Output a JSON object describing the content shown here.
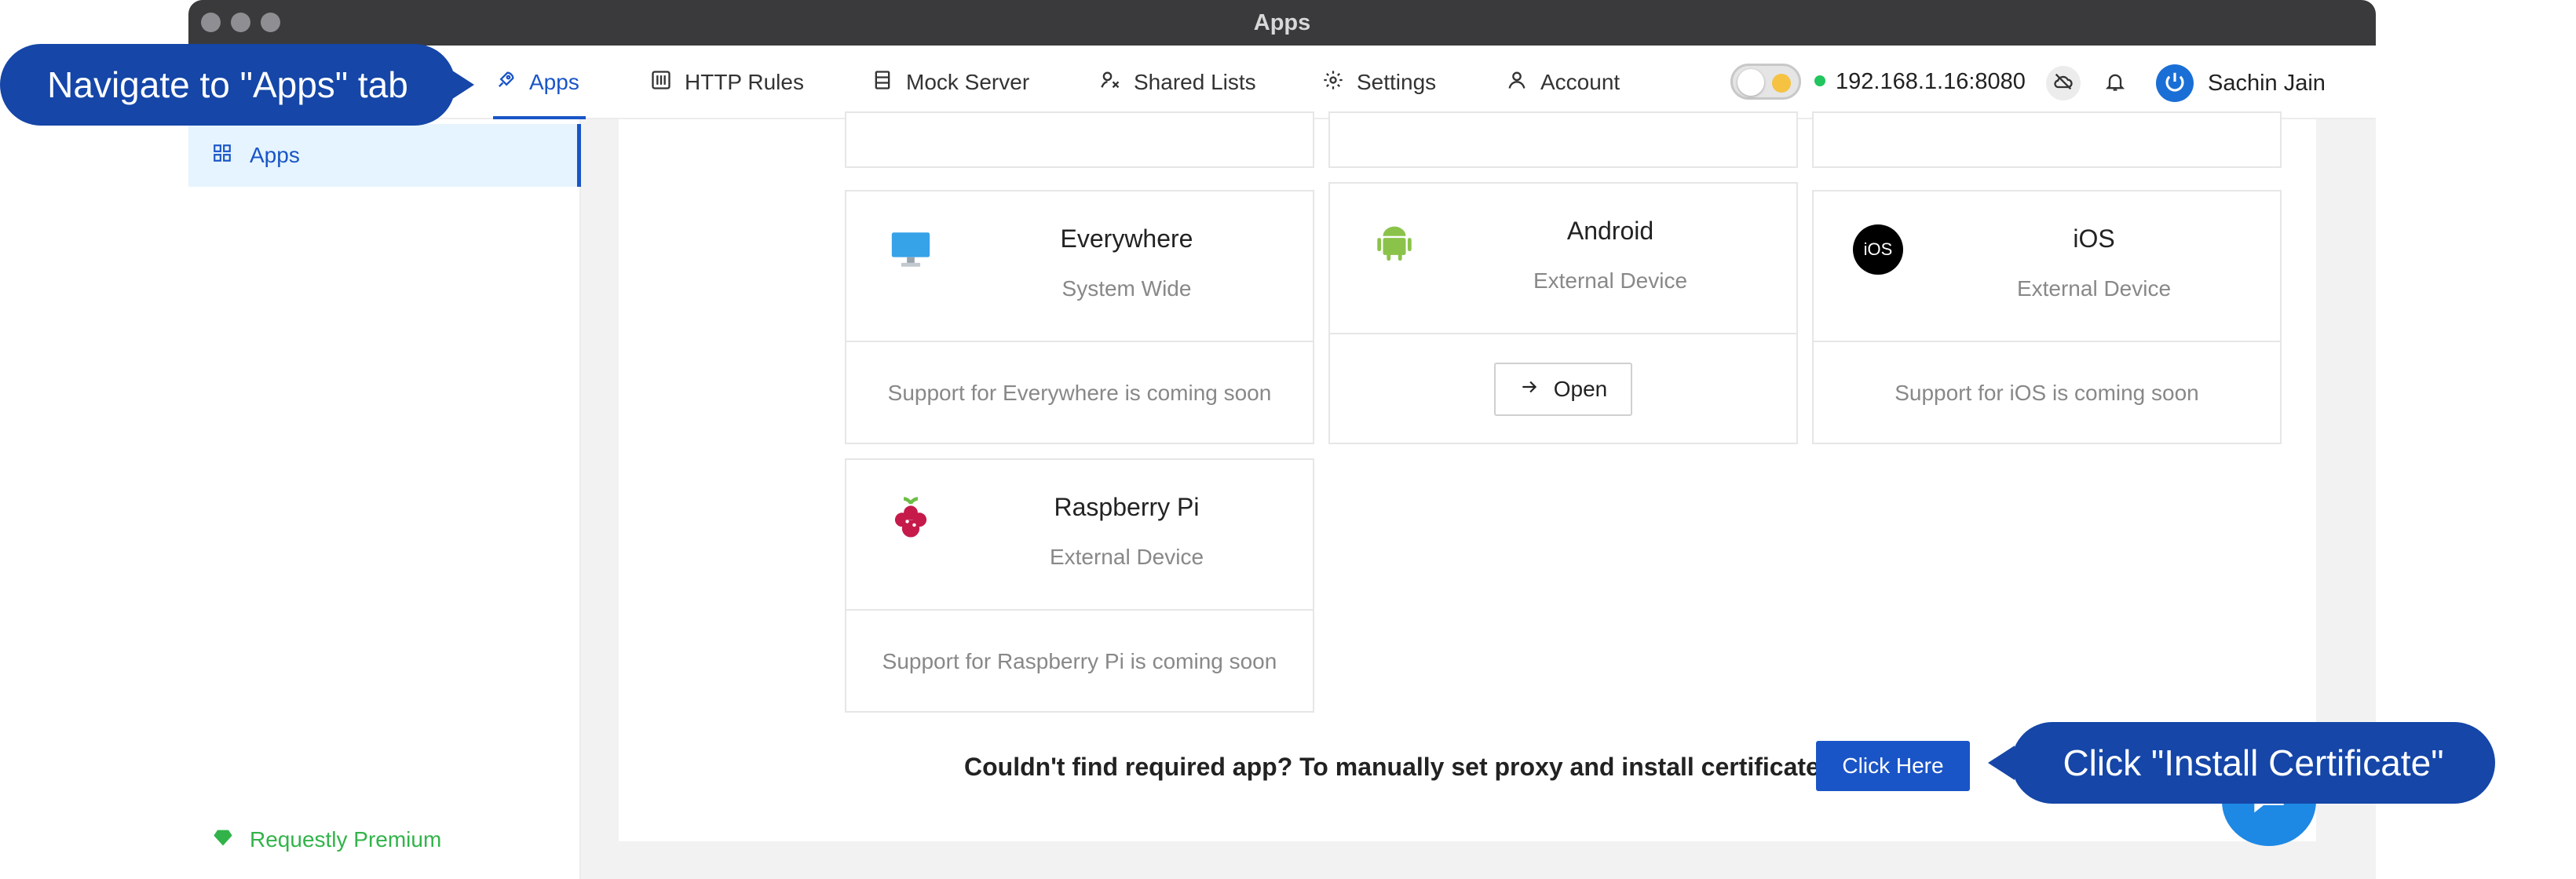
{
  "window": {
    "title": "Apps"
  },
  "nav": {
    "items": [
      {
        "label": "Apps",
        "icon": "rocket-icon"
      },
      {
        "label": "HTTP Rules",
        "icon": "sliders-icon"
      },
      {
        "label": "Mock Server",
        "icon": "server-icon"
      },
      {
        "label": "Shared Lists",
        "icon": "shared-lists-icon"
      },
      {
        "label": "Settings",
        "icon": "gear-icon"
      },
      {
        "label": "Account",
        "icon": "user-icon"
      }
    ],
    "active": "Apps",
    "ip_address": "192.168.1.16:8080",
    "user_name": "Sachin Jain"
  },
  "sidebar": {
    "items": [
      {
        "label": "Apps",
        "icon": "grid-icon"
      }
    ],
    "premium_label": "Requestly Premium"
  },
  "cards": [
    {
      "title": "Everywhere",
      "subtitle": "System Wide",
      "footer": "Support for Everywhere is coming soon",
      "icon": "monitor-icon"
    },
    {
      "title": "Android",
      "subtitle": "External Device",
      "button": "Open",
      "icon": "android-icon"
    },
    {
      "title": "iOS",
      "subtitle": "External Device",
      "footer": "Support for iOS is coming soon",
      "icon": "ios-icon",
      "icon_text": "iOS"
    },
    {
      "title": "Raspberry Pi",
      "subtitle": "External Device",
      "footer": "Support for Raspberry Pi is coming soon",
      "icon": "raspberry-pi-icon"
    }
  ],
  "manual_setup": {
    "prompt": "Couldn't find required app? To manually set proxy and install certificate",
    "button": "Click Here"
  },
  "callouts": {
    "left": "Navigate to \"Apps\" tab",
    "right": "Click \"Install Certificate\""
  },
  "colors": {
    "accent": "#1a55c7",
    "callout": "#1546a8",
    "premium": "#32b34a",
    "status_online": "#22c55e"
  }
}
